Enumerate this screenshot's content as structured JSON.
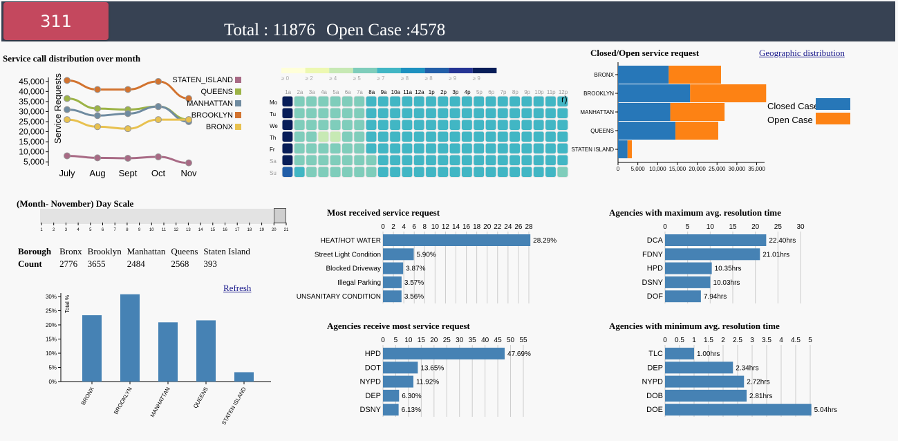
{
  "header": {
    "badge": "311",
    "total": "Total : 11876",
    "open": "Open Case :4578"
  },
  "line_chart": {
    "title": "Service call distribution over month"
  },
  "heatmap": {
    "legend": [
      "≥ 0",
      "≥ 2",
      "≥ 4",
      "≥ 5",
      "≥ 7",
      "≥ 8",
      "≥ 8",
      "≥ 9",
      "≥ 9"
    ],
    "legend_colors": [
      "#ffffd9",
      "#edf8b1",
      "#c7e9b4",
      "#7fcdbb",
      "#41b6c4",
      "#1d91c0",
      "#225ea8",
      "#253494",
      "#081d58"
    ],
    "hours": [
      "1a",
      "2a",
      "3a",
      "4a",
      "5a",
      "6a",
      "7a",
      "8a",
      "9a",
      "10a",
      "11a",
      "12a",
      "1p",
      "2p",
      "3p",
      "4p",
      "5p",
      "6p",
      "7p",
      "8p",
      "9p",
      "10p",
      "11p",
      "12p"
    ],
    "days": [
      "Mo",
      "Tu",
      "We",
      "Th",
      "Fr",
      "Sa",
      "Su"
    ],
    "partial_label": "r)"
  },
  "closed_open": {
    "title": "Closed/Open service request",
    "geo_link": "Geographic distribution",
    "legend_closed": "Closed Case",
    "legend_open": "Open Case",
    "closed_color": "#2777b8",
    "open_color": "#fd8214"
  },
  "day_scale": {
    "title": "(Month- November) Day Scale",
    "ticks": [
      "1",
      "2",
      "3",
      "4",
      "5",
      "6",
      "7",
      "8",
      "9",
      "10",
      "11",
      "12",
      "13",
      "14",
      "15",
      "16",
      "17",
      "18",
      "19",
      "20",
      "21"
    ],
    "value": 20
  },
  "borough_table": {
    "h1": "Borough",
    "h2": "Count",
    "names": [
      "Bronx",
      "Brooklyn",
      "Manhattan",
      "Queens",
      "Staten Island"
    ],
    "counts": [
      "2776",
      "3655",
      "2484",
      "2568",
      "393"
    ]
  },
  "refresh": "Refresh",
  "most_received": {
    "title": "Most received service request"
  },
  "agencies_most": {
    "title": "Agencies receive most service request"
  },
  "agencies_max": {
    "title": "Agencies with maximum avg. resolution time"
  },
  "agencies_min": {
    "title": "Agencies with minimum avg. resolution time"
  },
  "chart_data": [
    {
      "type": "line",
      "title": "Service call distribution over month",
      "ylabel": "Service Requests",
      "categories": [
        "July",
        "Aug",
        "Sept",
        "Oct",
        "Nov"
      ],
      "yticks": [
        "5,000",
        "10,000",
        "15,000",
        "20,000",
        "25,000",
        "30,000",
        "35,000",
        "40,000",
        "45,000"
      ],
      "ylim": [
        3000,
        47000
      ],
      "series": [
        {
          "name": "STATEN_ISLAND",
          "color": "#a86a85",
          "values": [
            8000,
            7000,
            6800,
            7500,
            4500
          ]
        },
        {
          "name": "QUEENS",
          "color": "#9cb346",
          "values": [
            36500,
            31500,
            31000,
            32500,
            26000
          ]
        },
        {
          "name": "MANHATTAN",
          "color": "#6f8ba0",
          "values": [
            31000,
            28000,
            29000,
            32500,
            25000
          ]
        },
        {
          "name": "BROOKLYN",
          "color": "#d2732f",
          "values": [
            45500,
            41000,
            41000,
            45000,
            36500
          ]
        },
        {
          "name": "BRONX",
          "color": "#e8c14f",
          "values": [
            26000,
            22500,
            21500,
            26000,
            26000
          ]
        }
      ]
    },
    {
      "type": "heatmap",
      "rows": [
        "Mo",
        "Tu",
        "We",
        "Th",
        "Fr",
        "Sa",
        "Su"
      ],
      "columns": [
        "1a",
        "2a",
        "3a",
        "4a",
        "5a",
        "6a",
        "7a",
        "8a",
        "9a",
        "10a",
        "11a",
        "12a",
        "1p",
        "2p",
        "3p",
        "4p",
        "5p",
        "6p",
        "7p",
        "8p",
        "9p",
        "10p",
        "11p",
        "12p"
      ],
      "values": [
        [
          9,
          4,
          4,
          4,
          4,
          4,
          4,
          5,
          5,
          5,
          5,
          5,
          5,
          5,
          5,
          5,
          5,
          5,
          5,
          5,
          5,
          5,
          5,
          5
        ],
        [
          9,
          4,
          4,
          4,
          4,
          4,
          4,
          5,
          5,
          5,
          5,
          5,
          5,
          5,
          5,
          5,
          5,
          5,
          5,
          5,
          5,
          5,
          5,
          5
        ],
        [
          9,
          4,
          4,
          4,
          4,
          4,
          4,
          5,
          5,
          5,
          5,
          5,
          5,
          5,
          5,
          5,
          5,
          5,
          5,
          5,
          5,
          5,
          5,
          5
        ],
        [
          9,
          4,
          4,
          3,
          3,
          4,
          4,
          5,
          5,
          5,
          5,
          5,
          5,
          5,
          5,
          5,
          5,
          5,
          5,
          5,
          5,
          5,
          5,
          5
        ],
        [
          9,
          4,
          4,
          4,
          4,
          4,
          4,
          5,
          5,
          5,
          5,
          5,
          5,
          5,
          5,
          5,
          5,
          5,
          5,
          5,
          5,
          5,
          5,
          5
        ],
        [
          9,
          4,
          4,
          4,
          4,
          4,
          4,
          4,
          5,
          5,
          5,
          5,
          5,
          5,
          5,
          5,
          5,
          5,
          5,
          5,
          5,
          5,
          5,
          5
        ],
        [
          7,
          5,
          4,
          4,
          4,
          4,
          4,
          4,
          5,
          5,
          5,
          5,
          5,
          5,
          5,
          5,
          5,
          5,
          5,
          5,
          5,
          5,
          5,
          4
        ]
      ]
    },
    {
      "type": "bar",
      "title": "Closed/Open service request",
      "orientation": "horizontal",
      "stacked": true,
      "categories": [
        "BRONX",
        "BROOKLYN",
        "MANHATTAN",
        "QUEENS",
        "STATEN ISLAND"
      ],
      "xlim": [
        0,
        37000
      ],
      "xticks": [
        "0",
        "5,000",
        "10,000",
        "15,000",
        "20,000",
        "25,000",
        "30,000",
        "35,000"
      ],
      "series": [
        {
          "name": "Closed Case",
          "values": [
            12800,
            18200,
            13200,
            14500,
            2400
          ]
        },
        {
          "name": "Open Case",
          "values": [
            13200,
            19200,
            13700,
            10800,
            1100
          ]
        }
      ]
    },
    {
      "type": "bar",
      "ylabel": "Total %",
      "categories": [
        "BRONX",
        "BROOKLYN",
        "MANHATTAN",
        "QUEENS",
        "STATEN ISLAND"
      ],
      "yticks": [
        "0%",
        "5%",
        "10%",
        "15%",
        "20%",
        "25%",
        "30%"
      ],
      "ylim": [
        0,
        31
      ],
      "values": [
        23.4,
        30.8,
        20.9,
        21.6,
        3.3
      ]
    },
    {
      "type": "bar",
      "title": "Most received service request",
      "orientation": "horizontal",
      "xlim": [
        0,
        28
      ],
      "xticks": [
        "0",
        "2",
        "4",
        "6",
        "8",
        "10",
        "12",
        "14",
        "16",
        "18",
        "20",
        "22",
        "24",
        "26",
        "28"
      ],
      "categories": [
        "HEAT/HOT WATER",
        "Street Light Condition",
        "Blocked Driveway",
        "Illegal Parking",
        "UNSANITARY CONDITION"
      ],
      "values": [
        28.29,
        5.9,
        3.87,
        3.57,
        3.56
      ],
      "labels": [
        "28.29%",
        "5.90%",
        "3.87%",
        "3.57%",
        "3.56%"
      ]
    },
    {
      "type": "bar",
      "title": "Agencies receive most service request",
      "orientation": "horizontal",
      "xlim": [
        0,
        55
      ],
      "xticks": [
        "0",
        "5",
        "10",
        "15",
        "20",
        "25",
        "30",
        "35",
        "40",
        "45",
        "50",
        "55"
      ],
      "categories": [
        "HPD",
        "DOT",
        "NYPD",
        "DEP",
        "DSNY"
      ],
      "values": [
        47.69,
        13.65,
        11.92,
        6.3,
        6.13
      ],
      "labels": [
        "47.69%",
        "13.65%",
        "11.92%",
        "6.30%",
        "6.13%"
      ]
    },
    {
      "type": "bar",
      "title": "Agencies with maximum avg. resolution time",
      "orientation": "horizontal",
      "xlim": [
        0,
        30
      ],
      "xticks": [
        "0",
        "5",
        "10",
        "15",
        "20",
        "25",
        "30"
      ],
      "categories": [
        "DCA",
        "FDNY",
        "HPD",
        "DSNY",
        "DOF"
      ],
      "values": [
        22.4,
        21.01,
        10.35,
        10.03,
        7.94
      ],
      "labels": [
        "22.40hrs",
        "21.01hrs",
        "10.35hrs",
        "10.03hrs",
        "7.94hrs"
      ]
    },
    {
      "type": "bar",
      "title": "Agencies with minimum avg. resolution time",
      "orientation": "horizontal",
      "xlim": [
        0,
        5
      ],
      "xticks": [
        "0",
        "0.5",
        "1",
        "1.5",
        "2",
        "2.5",
        "3",
        "3.5",
        "4",
        "4.5",
        "5"
      ],
      "categories": [
        "TLC",
        "DEP",
        "NYPD",
        "DOB",
        "DOE"
      ],
      "values": [
        1.0,
        2.34,
        2.72,
        2.81,
        5.04
      ],
      "labels": [
        "1.00hrs",
        "2.34hrs",
        "2.72hrs",
        "2.81hrs",
        "5.04hrs"
      ]
    }
  ]
}
